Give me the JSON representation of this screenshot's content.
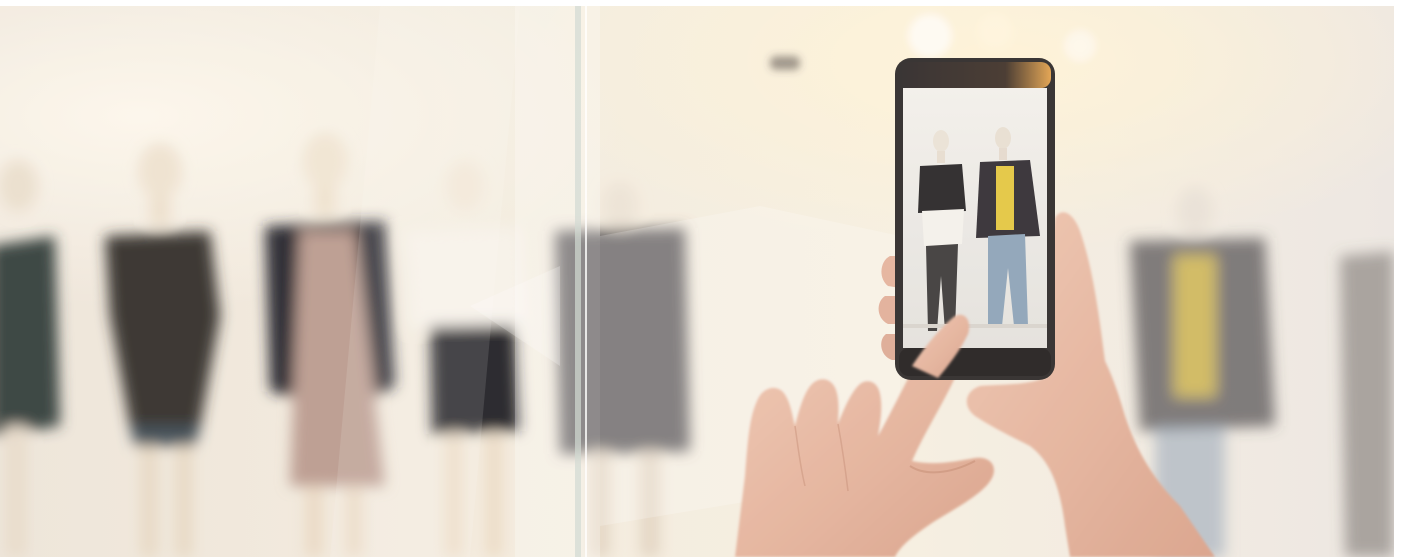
{
  "image": {
    "subject": "hands-holding-smartphone-photographing-mannequins",
    "colors": {
      "background_warm": "#efe4d3",
      "background_light": "#f8f4ee",
      "glass": "#f4f2ee",
      "phone_frame": "#2a2626",
      "phone_screen": "#e9e7e4",
      "skin": "#e6b9a3",
      "skin_shadow": "#c98f78",
      "dark_clothing": "#2c2928",
      "yellow_top": "#e4c540",
      "jeans": "#8aa0b6"
    },
    "icons": [
      "smartphone-icon",
      "hand-icon",
      "mannequin-icon"
    ]
  }
}
